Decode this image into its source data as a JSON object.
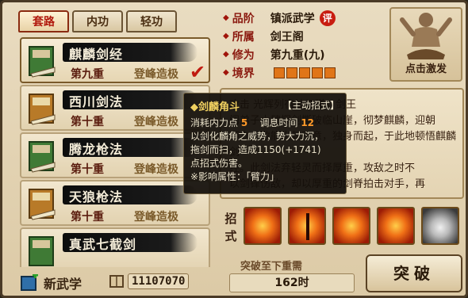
{
  "tabs": [
    {
      "label": "套路",
      "active": true
    },
    {
      "label": "内功",
      "active": false
    },
    {
      "label": "轻功",
      "active": false
    }
  ],
  "skills": [
    {
      "name": "麒麟剑经",
      "level": "第九重",
      "rank": "登峰造极",
      "selected": true
    },
    {
      "name": "西川剑法",
      "level": "第十重",
      "rank": "登峰造极"
    },
    {
      "name": "腾龙枪法",
      "level": "第十重",
      "rank": "登峰造极"
    },
    {
      "name": "天狼枪法",
      "level": "第十重",
      "rank": "登峰造极"
    },
    {
      "name": "真武七截剑",
      "level": "",
      "rank": ""
    }
  ],
  "footer": {
    "new_martial": "新武学",
    "coins": "11107070"
  },
  "attributes": [
    {
      "key": "品阶",
      "value": "镇派武学",
      "badge": "评"
    },
    {
      "key": "所属",
      "value": "剑王阁"
    },
    {
      "key": "修为",
      "value": "第九重(九)"
    },
    {
      "key": "境界",
      "value": "",
      "realm_blocks": 5
    }
  ],
  "activate": {
    "label": "点击激发"
  },
  "description": {
    "line1": "攻击                    光辉列宿灿初曦」剑王",
    "line2": "阁弟子大肆挥剑撕破临山崖，彻梦麒麟，迎朝",
    "line3": "而立，敌能出其不意，独身而起，于此地顿悟麒麟剑",
    "line4": "经。此剑法弃轻灵而择厚重，攻敌之时不",
    "line5": "以剑锋伤敌，却以厚重的剑脊拍击对手，再"
  },
  "moves": {
    "label_line1": "招",
    "label_line2": "式",
    "count": 5
  },
  "breakthrough": {
    "requirement_label": "突破至下重需",
    "time": "162时",
    "button_label": "突破"
  },
  "tooltip": {
    "title": "◆剑麟角斗",
    "tag": "【主动招式】",
    "cost_label": "消耗内力点",
    "cost_value": "5",
    "cooldown_label": "调息时间",
    "cooldown_value": "12",
    "line1": "以剑化麟角之威势，势大力沉，",
    "line2": "拖剑而扫，造成1150(+1741)",
    "line3": "点招式伤害。",
    "line4": "※影响属性：「臂力」"
  },
  "colors": {
    "accent_red": "#c81c10",
    "gold": "#f0d060",
    "orange": "#e07518"
  }
}
